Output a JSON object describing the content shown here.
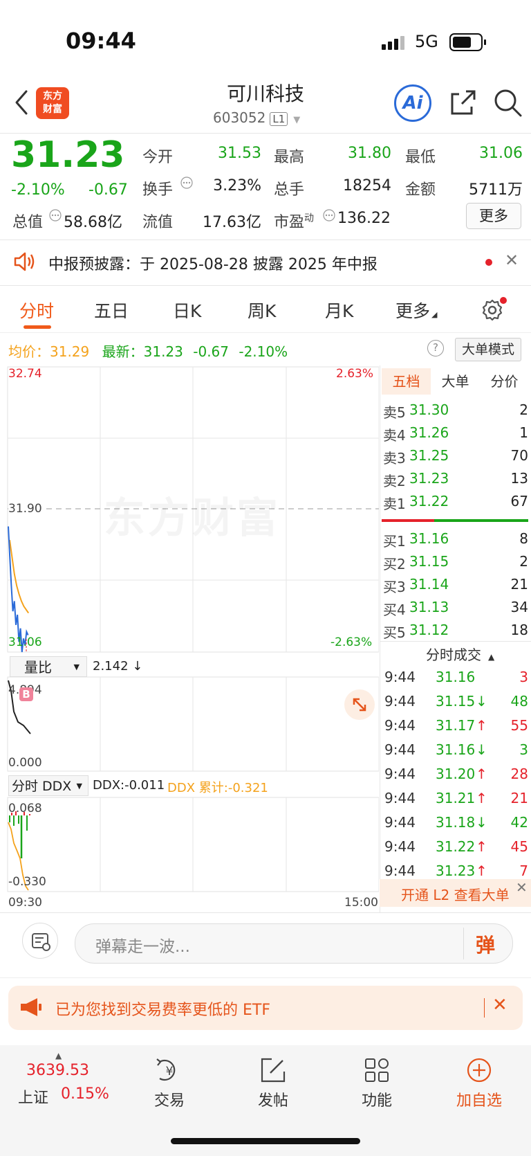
{
  "status_bar": {
    "time": "09:44",
    "network": "5G"
  },
  "header": {
    "logo_line1": "东方",
    "logo_line2": "财富",
    "stock_name": "可川科技",
    "stock_code": "603052",
    "level": "L1",
    "ai_label": "Ai"
  },
  "quote": {
    "price": "31.23",
    "change_pct": "-2.10%",
    "change_abs": "-0.67",
    "open_label": "今开",
    "open": "31.53",
    "high_label": "最高",
    "high": "31.80",
    "low_label": "最低",
    "low": "31.06",
    "turnover_label": "换手",
    "turnover": "3.23%",
    "volume_label": "总手",
    "volume": "18254",
    "amount_label": "金额",
    "amount": "5711万",
    "mktcap_label": "总值",
    "mktcap": "58.68亿",
    "float_label": "流值",
    "float_cap": "17.63亿",
    "pe_label": "市盈",
    "pe_sup": "动",
    "pe": "136.22",
    "more_label": "更多"
  },
  "notice": {
    "text": "中报预披露：于 2025-08-28 披露 2025 年中报"
  },
  "tabs": [
    "分时",
    "五日",
    "日K",
    "周K",
    "月K",
    "更多"
  ],
  "chart": {
    "avg_label": "均价：",
    "avg_value": "31.29",
    "latest_label": "最新：",
    "latest_value": "31.23",
    "latest_change": "-0.67",
    "latest_pct": "-2.10%",
    "help": "?",
    "big_order_btn": "大单模式",
    "price_top": "32.74",
    "price_mid": "31.90",
    "price_bottom": "31.06",
    "pct_top": "2.63%",
    "pct_bottom": "-2.63%",
    "vol_selector": "量比",
    "vol_ratio": "2.142 ↓",
    "vol_top": "4.894",
    "vol_bottom": "0.000",
    "b_marker": "B",
    "ddx_selector": "分时 DDX",
    "ddx_value": "DDX:-0.011",
    "ddx_cum": "DDX 累计:-0.321",
    "ddx_top": "0.068",
    "ddx_bottom": "-0.330",
    "time_start": "09:30",
    "time_end": "15:00",
    "watermark": "东方财富",
    "colors": {
      "price_line": "#2a6ad8",
      "avg_line": "#f4a21c",
      "ratio_line": "#222222",
      "up": "#e5222b",
      "down": "#1aa51a"
    }
  },
  "order_book": {
    "tabs": [
      "五档",
      "大单",
      "分价"
    ],
    "asks": [
      {
        "label": "卖5",
        "price": "31.30",
        "vol": "2"
      },
      {
        "label": "卖4",
        "price": "31.26",
        "vol": "1"
      },
      {
        "label": "卖3",
        "price": "31.25",
        "vol": "70"
      },
      {
        "label": "卖2",
        "price": "31.23",
        "vol": "13"
      },
      {
        "label": "卖1",
        "price": "31.22",
        "vol": "67"
      }
    ],
    "bids": [
      {
        "label": "买1",
        "price": "31.16",
        "vol": "8"
      },
      {
        "label": "买2",
        "price": "31.15",
        "vol": "2"
      },
      {
        "label": "买3",
        "price": "31.14",
        "vol": "21"
      },
      {
        "label": "买4",
        "price": "31.13",
        "vol": "34"
      },
      {
        "label": "买5",
        "price": "31.12",
        "vol": "18"
      }
    ]
  },
  "ticks": {
    "title": "分时成交",
    "rows": [
      {
        "time": "9:44",
        "price": "31.16",
        "dir": "",
        "vol": "3",
        "side": "sell"
      },
      {
        "time": "9:44",
        "price": "31.15",
        "dir": "↓",
        "vol": "48",
        "side": "buy"
      },
      {
        "time": "9:44",
        "price": "31.17",
        "dir": "↑",
        "vol": "55",
        "side": "sell"
      },
      {
        "time": "9:44",
        "price": "31.16",
        "dir": "↓",
        "vol": "3",
        "side": "buy"
      },
      {
        "time": "9:44",
        "price": "31.20",
        "dir": "↑",
        "vol": "28",
        "side": "sell"
      },
      {
        "time": "9:44",
        "price": "31.21",
        "dir": "↑",
        "vol": "21",
        "side": "sell"
      },
      {
        "time": "9:44",
        "price": "31.18",
        "dir": "↓",
        "vol": "42",
        "side": "buy"
      },
      {
        "time": "9:44",
        "price": "31.22",
        "dir": "↑",
        "vol": "45",
        "side": "sell"
      },
      {
        "time": "9:44",
        "price": "31.23",
        "dir": "↑",
        "vol": "7",
        "side": "sell"
      }
    ]
  },
  "l2_banner": {
    "text": "开通 L2 查看大单"
  },
  "danmaku": {
    "placeholder": "弹幕走一波...",
    "send_label": "弹"
  },
  "etf_banner": {
    "text": "已为您找到交易费率更低的 ETF"
  },
  "bottom_nav": {
    "index_value": "3639.53",
    "index_name": "上证",
    "index_change": "0.15%",
    "items": [
      {
        "label": "交易",
        "icon": "yuan-exchange-icon"
      },
      {
        "label": "发帖",
        "icon": "edit-post-icon"
      },
      {
        "label": "功能",
        "icon": "grid-icon"
      },
      {
        "label": "加自选",
        "icon": "add-circle-icon"
      }
    ]
  }
}
